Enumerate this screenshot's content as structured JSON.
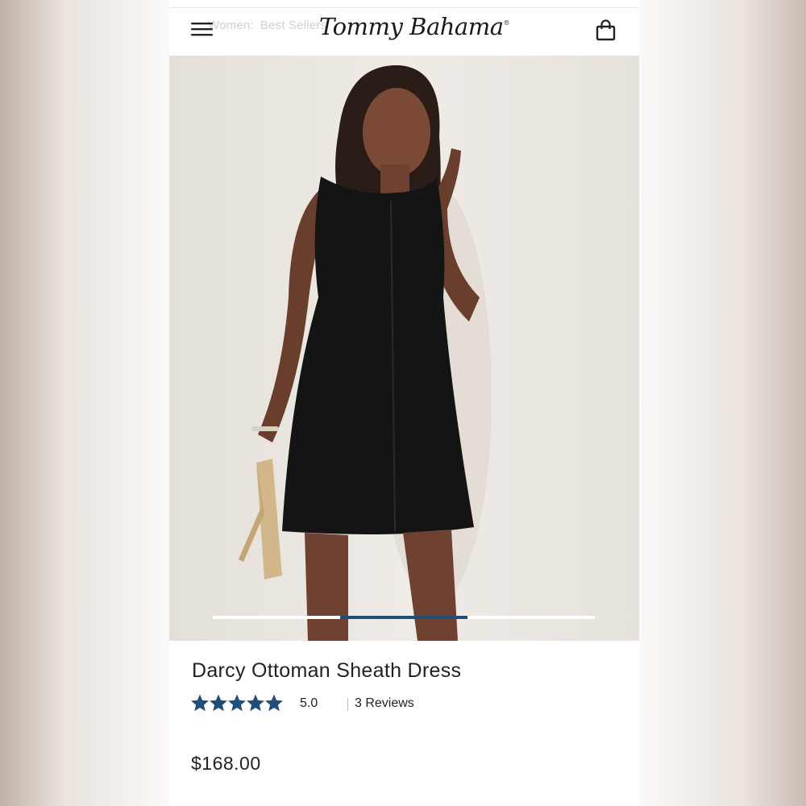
{
  "header": {
    "breadcrumb": [
      "Women:",
      "Best Sellers"
    ],
    "brand": "Tommy Bahama",
    "brand_mark": "®"
  },
  "icons": {
    "menu": "hamburger-menu-icon",
    "cart": "shopping-bag-icon",
    "star": "star-icon"
  },
  "gallery": {
    "slide_count": 3,
    "active_slide": 2
  },
  "product": {
    "name": "Darcy Ottoman Sheath Dress",
    "rating": "5.0",
    "stars": 5,
    "reviews": "3 Reviews",
    "price": "$168.00"
  },
  "colors": {
    "accent": "#1f4e79",
    "star": "#1f4e79",
    "pager_inactive": "#ffffff",
    "text": "#222222"
  }
}
